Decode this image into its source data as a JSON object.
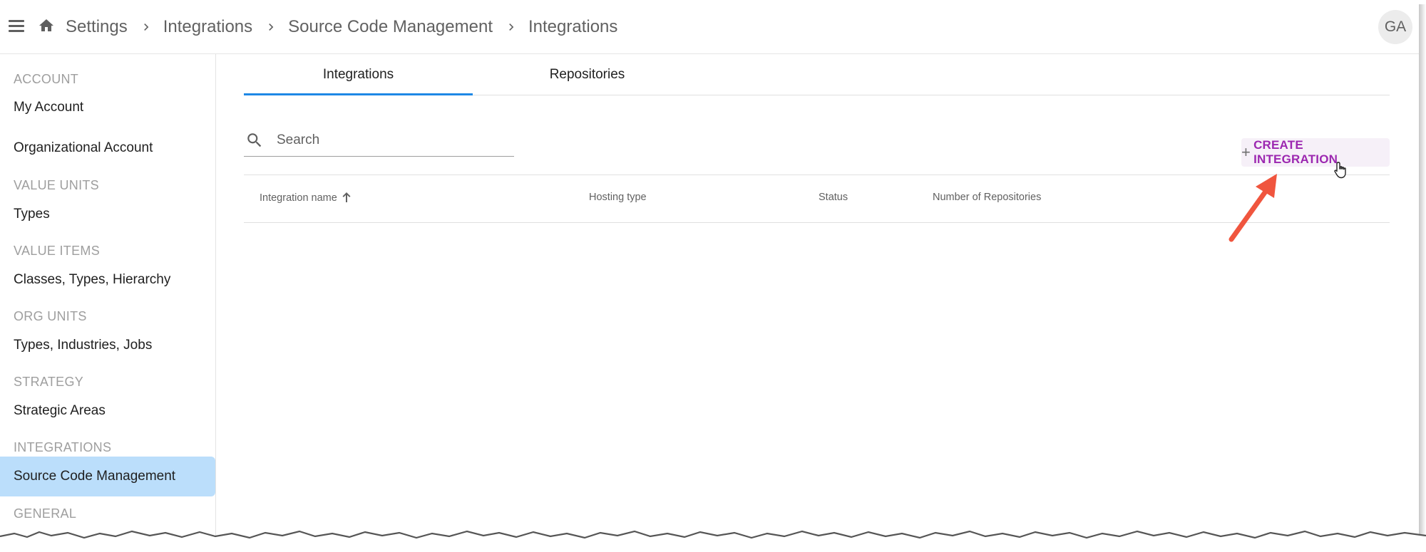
{
  "breadcrumb": [
    "Settings",
    "Integrations",
    "Source Code Management",
    "Integrations"
  ],
  "user": {
    "initials": "GA"
  },
  "sidebar": {
    "sections": [
      {
        "header": "ACCOUNT",
        "items": [
          "My Account",
          "Organizational Account"
        ]
      },
      {
        "header": "VALUE UNITS",
        "items": [
          "Types"
        ]
      },
      {
        "header": "VALUE ITEMS",
        "items": [
          "Classes, Types, Hierarchy"
        ]
      },
      {
        "header": "ORG UNITS",
        "items": [
          "Types, Industries, Jobs"
        ]
      },
      {
        "header": "STRATEGY",
        "items": [
          "Strategic Areas"
        ]
      },
      {
        "header": "INTEGRATIONS",
        "items": [
          "Source Code Management"
        ]
      },
      {
        "header": "GENERAL",
        "items": []
      }
    ],
    "active_item": "Source Code Management"
  },
  "tabs": [
    {
      "label": "Integrations",
      "active": true
    },
    {
      "label": "Repositories",
      "active": false
    }
  ],
  "search": {
    "placeholder": "Search",
    "value": ""
  },
  "create_button": {
    "icon": "plus-icon",
    "label": "CREATE INTEGRATION"
  },
  "table": {
    "columns": [
      {
        "label": "Integration name",
        "sort": "ascending"
      },
      {
        "label": "Hosting type"
      },
      {
        "label": "Status"
      },
      {
        "label": "Number of Repositories"
      }
    ],
    "rows": []
  },
  "colors": {
    "accent_blue": "#1e88e5",
    "active_nav_bg": "#bbdefb",
    "button_text_purple": "#9c27b0",
    "annotation_arrow": "#f0553e"
  }
}
